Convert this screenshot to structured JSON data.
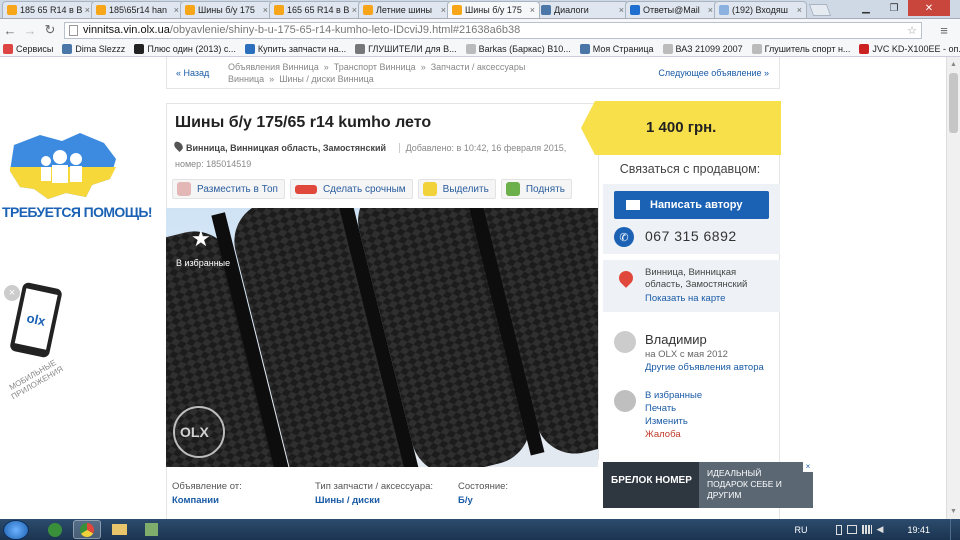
{
  "browser": {
    "tabs": [
      {
        "label": "185 65 R14 в В",
        "fav": "olx"
      },
      {
        "label": "185\\65r14 han",
        "fav": "olx"
      },
      {
        "label": "Шины б/у 175",
        "fav": "olx"
      },
      {
        "label": "165 65 R14 в В",
        "fav": "olx"
      },
      {
        "label": "Летние шины",
        "fav": "olx"
      },
      {
        "label": "Шины б/у 175",
        "fav": "olx"
      },
      {
        "label": "Диалоги",
        "fav": "vk"
      },
      {
        "label": "Ответы@Mail",
        "fav": "mail"
      },
      {
        "label": "(192) Входяш",
        "fav": "load"
      }
    ],
    "url_host": "vinnitsa.vin.olx.ua",
    "url_path": "/obyavlenie/shiny-b-u-175-65-r14-kumho-leto-IDcviJ9.html#21638a6b38",
    "bookmarks": [
      "Сервисы",
      "Dima Slezzz",
      "Плюс один (2013) с...",
      "Купить запчасти на...",
      "ГЛУШИТЕЛИ для В...",
      "Barkas (Баркас) B10...",
      "Моя Страница",
      "ВАЗ 21099 2007",
      "Глушитель спорт н...",
      "JVC KD-X100EE - оп..."
    ]
  },
  "sidebar_ads": {
    "help_text": "ТРЕБУЕТСЯ ПОМОЩЬ!",
    "mobile_text": "МОБИЛЬНЫЕ ПРИЛОЖЕНИЯ",
    "olx_badge": "olx"
  },
  "breadcrumb": {
    "back": "« Назад",
    "items": [
      "Объявления Винница",
      "Транспорт Винница",
      "Запчасти / аксессуары Винница",
      "Шины / диски Винница"
    ],
    "sep": "»",
    "next": "Следующее объявление »"
  },
  "listing": {
    "title": "Шины б/у 175/65 r14 kumho лето",
    "location": "Винница, Винницкая область, Замостянский",
    "added": "Добавлено: в 10:42, 16 февраля 2015,",
    "number": "номер: 185014519",
    "price": "1 400 грн.",
    "actions": [
      "Разместить в Топ",
      "Сделать срочным",
      "Выделить",
      "Поднять"
    ],
    "favorite_label": "В избранные",
    "watermark": "OLX",
    "params": [
      {
        "label": "Объявление от:",
        "value": "Компании"
      },
      {
        "label": "Тип запчасти / аксессуара:",
        "value": "Шины / диски"
      },
      {
        "label": "Состояние:",
        "value": "Б/у"
      }
    ]
  },
  "seller": {
    "contact_title": "Связаться с продавцом:",
    "write_button": "Написать автору",
    "phone": "067 315 6892",
    "address": "Винница, Винницкая область, Замостянский",
    "show_map": "Показать на карте",
    "name": "Владимир",
    "since": "на OLX с мая 2012",
    "other_ads": "Другие объявления автора",
    "links": [
      "В избранные",
      "Печать",
      "Изменить",
      "Жалоба"
    ]
  },
  "banner": {
    "left_text": "БРЕЛОК НОМЕР",
    "right_text": "ИДЕАЛЬНЫЙ ПОДАРОК СЕБЕ И ДРУГИМ"
  },
  "taskbar": {
    "lang": "RU",
    "time": "19:41"
  },
  "colors": {
    "price_bg": "#f8e04a",
    "olx_blue": "#1b62b4",
    "link": "#1a5ba6"
  }
}
